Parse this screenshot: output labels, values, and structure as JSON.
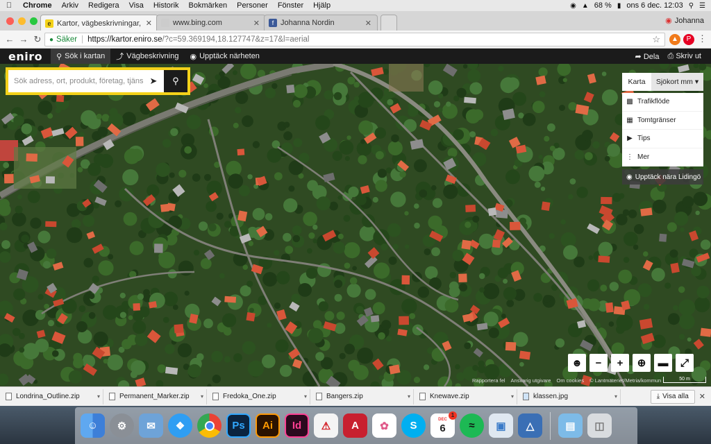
{
  "menubar": {
    "app": "Chrome",
    "items": [
      "Arkiv",
      "Redigera",
      "Visa",
      "Historik",
      "Bokmärken",
      "Personer",
      "Fönster",
      "Hjälp"
    ],
    "battery": "68 %",
    "clock": "ons 6 dec.  12:03"
  },
  "tabs": [
    {
      "title": "Kartor, vägbeskrivningar, flygfoto",
      "active": true
    },
    {
      "title": "www.bing.com",
      "active": false
    },
    {
      "title": "Johanna Nordin",
      "active": false
    }
  ],
  "profile_name": "Johanna",
  "address": {
    "secure_label": "Säker",
    "host": "https://kartor.eniro.se",
    "path": "/?c=59.369194,18.127747&z=17&l=aerial"
  },
  "eniro": {
    "logo": "eniro",
    "tabs": [
      "Sök i kartan",
      "Vägbeskrivning",
      "Upptäck närheten"
    ],
    "share": "Dela",
    "print": "Skriv ut"
  },
  "search": {
    "placeholder": "Sök adress, ort, produkt, företag, tjänst"
  },
  "map_type": {
    "karta": "Karta",
    "selected": "Sjökort mm"
  },
  "layers": [
    {
      "label": "Trafikflöde",
      "icon": "car-icon"
    },
    {
      "label": "Tomtgränser",
      "icon": "property-boundary-icon"
    },
    {
      "label": "Tips",
      "icon": "megaphone-icon"
    },
    {
      "label": "Mer",
      "icon": "more-vertical-icon"
    }
  ],
  "discover_label": "Upptäck nära Lidingö",
  "attribution": {
    "report": "Rapportera fel",
    "publisher": "Ansvarig utgivare",
    "cookies": "Om cookies",
    "copyright": "© Lantmäteriet/Metria/kommun"
  },
  "scale_label": "50 m",
  "downloads": [
    "Londrina_Outline.zip",
    "Permanent_Marker.zip",
    "Fredoka_One.zip",
    "Bangers.zip",
    "Knewave.zip",
    "klassen.jpg"
  ],
  "show_all": "Visa alla",
  "dock": {
    "calendar_month": "DEC",
    "calendar_day": "6",
    "calendar_badge": "1",
    "apps": [
      "Finder",
      "Systeminställningar",
      "Mail",
      "Safari",
      "Chrome",
      "Photoshop",
      "Illustrator",
      "InDesign",
      "Acrobat",
      "AutoCAD",
      "Bilder",
      "Skype",
      "Kalender",
      "Spotify",
      "Förhandsvisning",
      "ArchiCAD",
      "Mapp",
      "Papperskorg"
    ]
  },
  "colors": {
    "eniro_accent": "#f4d21a",
    "roof": "#d9563a",
    "vegetation": "#2f4a22"
  }
}
